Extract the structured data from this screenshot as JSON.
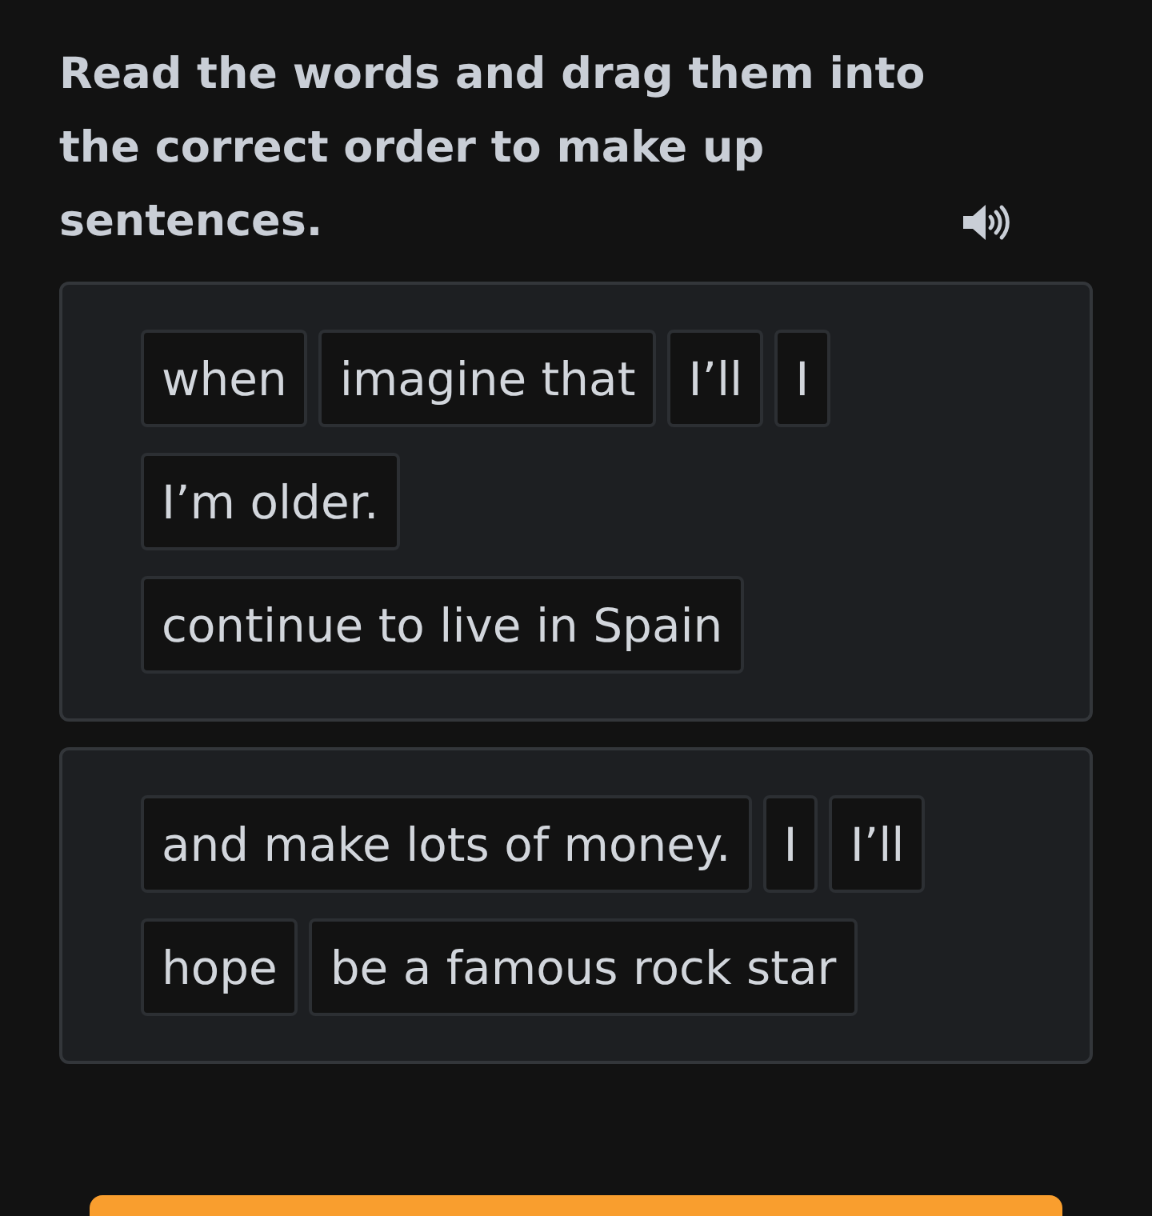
{
  "instruction": {
    "text": "Read the words and drag them into the correct order to make up sentences."
  },
  "groups": [
    {
      "chips": [
        "when",
        "imagine that",
        "I’ll",
        "I",
        "I’m older.",
        "continue to live in Spain"
      ]
    },
    {
      "chips": [
        "and make lots of money.",
        "I",
        "I’ll",
        "hope",
        "be a famous rock star"
      ]
    }
  ]
}
